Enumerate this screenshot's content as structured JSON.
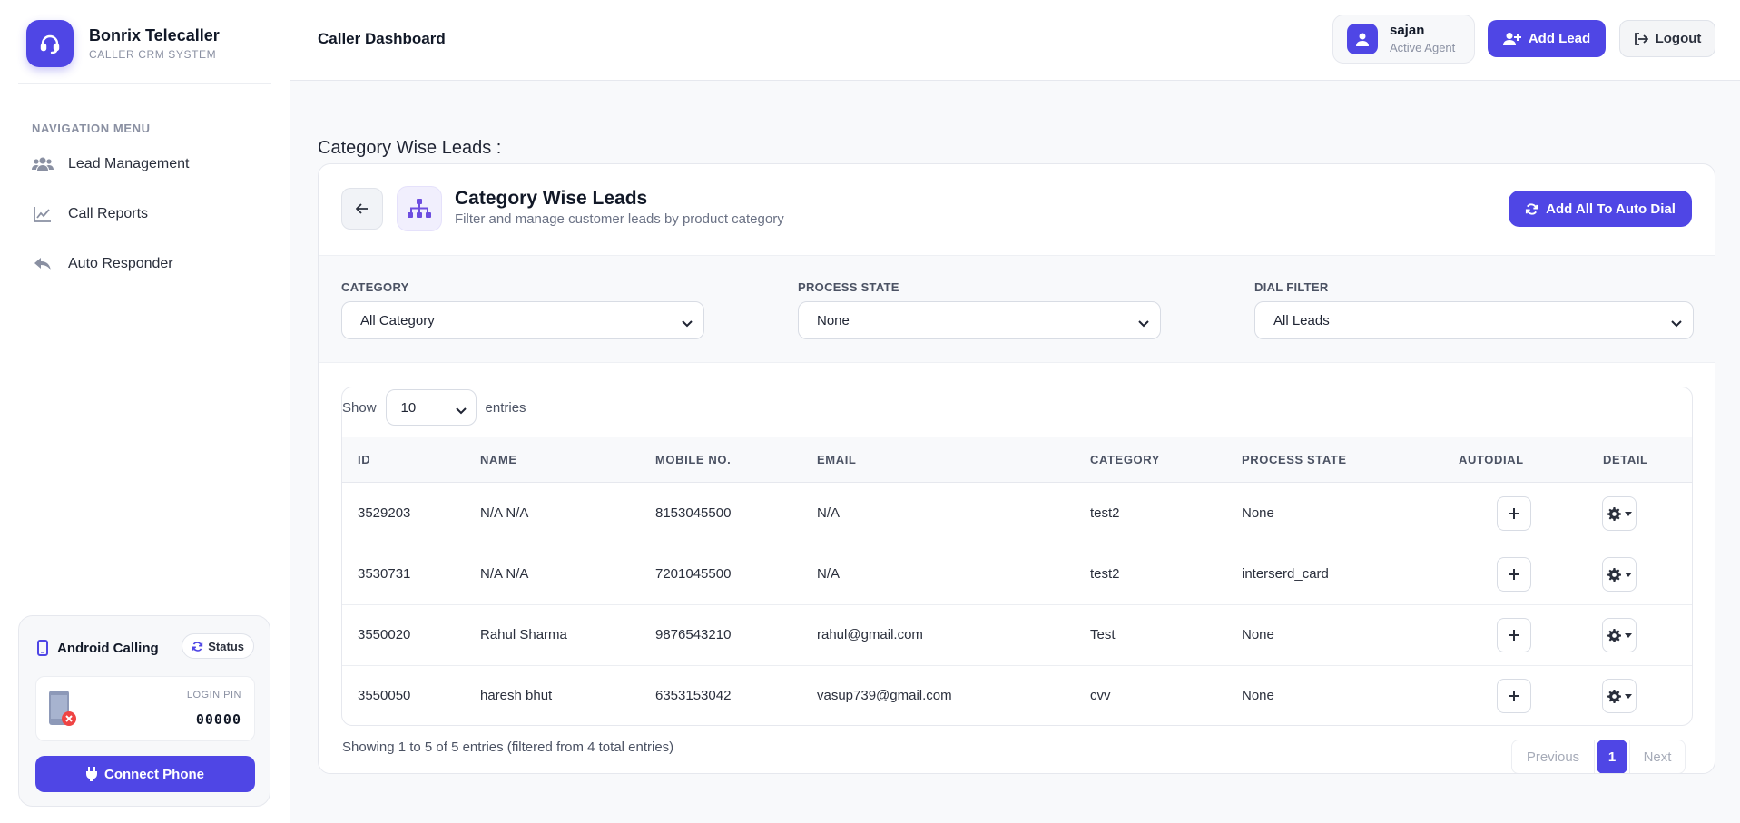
{
  "brand": {
    "title": "Bonrix Telecaller",
    "subtitle": "CALLER CRM SYSTEM"
  },
  "sidebar": {
    "heading": "NAVIGATION MENU",
    "items": [
      {
        "label": "Lead Management",
        "icon": "users-icon"
      },
      {
        "label": "Call Reports",
        "icon": "chart-line-icon"
      },
      {
        "label": "Auto Responder",
        "icon": "reply-icon"
      }
    ],
    "android": {
      "title": "Android Calling",
      "status_label": "Status",
      "pin_label": "LOGIN PIN",
      "pin_value": "00000",
      "connect_label": "Connect Phone"
    }
  },
  "header": {
    "title": "Caller Dashboard",
    "user": {
      "name": "sajan",
      "role": "Active Agent"
    },
    "add_lead_label": "Add Lead",
    "logout_label": "Logout"
  },
  "main": {
    "section_title": "Category Wise Leads :",
    "card": {
      "title": "Category Wise Leads",
      "subtitle": "Filter and manage customer leads by product category",
      "auto_dial_label": "Add All To Auto Dial"
    },
    "filters": [
      {
        "label": "CATEGORY",
        "value": "All Category"
      },
      {
        "label": "PROCESS STATE",
        "value": "None"
      },
      {
        "label": "DIAL FILTER",
        "value": "All Leads"
      }
    ],
    "table": {
      "show_label": "Show",
      "length_value": "10",
      "entries_label": "entries",
      "columns": [
        "ID",
        "NAME",
        "MOBILE NO.",
        "EMAIL",
        "CATEGORY",
        "PROCESS STATE",
        "AUTODIAL",
        "DETAIL"
      ],
      "rows": [
        {
          "id": "3529203",
          "name": "N/A N/A",
          "mobile": "8153045500",
          "email": "N/A",
          "category": "test2",
          "state": "None"
        },
        {
          "id": "3530731",
          "name": "N/A N/A",
          "mobile": "7201045500",
          "email": "N/A",
          "category": "test2",
          "state": "interserd_card"
        },
        {
          "id": "3550020",
          "name": "Rahul Sharma",
          "mobile": "9876543210",
          "email": "rahul@gmail.com",
          "category": "Test",
          "state": "None"
        },
        {
          "id": "3550050",
          "name": "haresh bhut",
          "mobile": "6353153042",
          "email": "vasup739@gmail.com",
          "category": "cvv",
          "state": "None"
        }
      ],
      "info": "Showing 1 to 5 of 5 entries (filtered from 4 total entries)",
      "pagination": {
        "previous": "Previous",
        "current": "1",
        "next": "Next"
      }
    }
  },
  "colors": {
    "accent": "#4f46e5",
    "danger": "#ef4444"
  }
}
